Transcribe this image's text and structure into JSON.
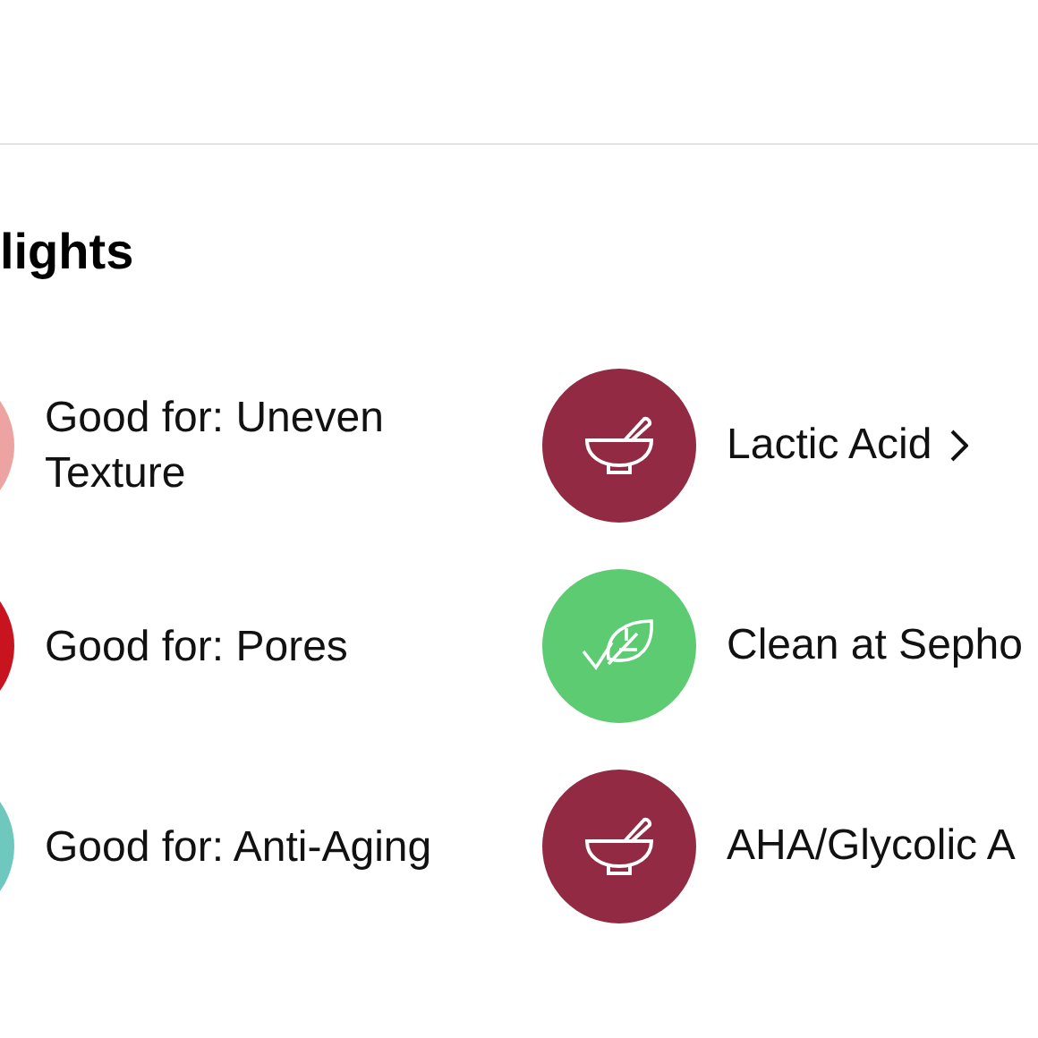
{
  "section": {
    "title": "lights"
  },
  "highlights": [
    {
      "kind": "benefit",
      "label": "Good for: Uneven Texture",
      "color": "#eda3a1",
      "link": false
    },
    {
      "kind": "ingredient",
      "label": "Lactic Acid",
      "color": "#922a44",
      "link": true
    },
    {
      "kind": "benefit",
      "label": "Good for: Pores",
      "color": "#c8141e",
      "link": false
    },
    {
      "kind": "clean",
      "label": "Clean at Sepho",
      "color": "#5ccb72",
      "link": false
    },
    {
      "kind": "benefit",
      "label": "Good for: Anti-Aging",
      "color": "#6fc8bd",
      "link": false
    },
    {
      "kind": "ingredient",
      "label": "AHA/Glycolic A",
      "color": "#922a44",
      "link": false
    }
  ]
}
